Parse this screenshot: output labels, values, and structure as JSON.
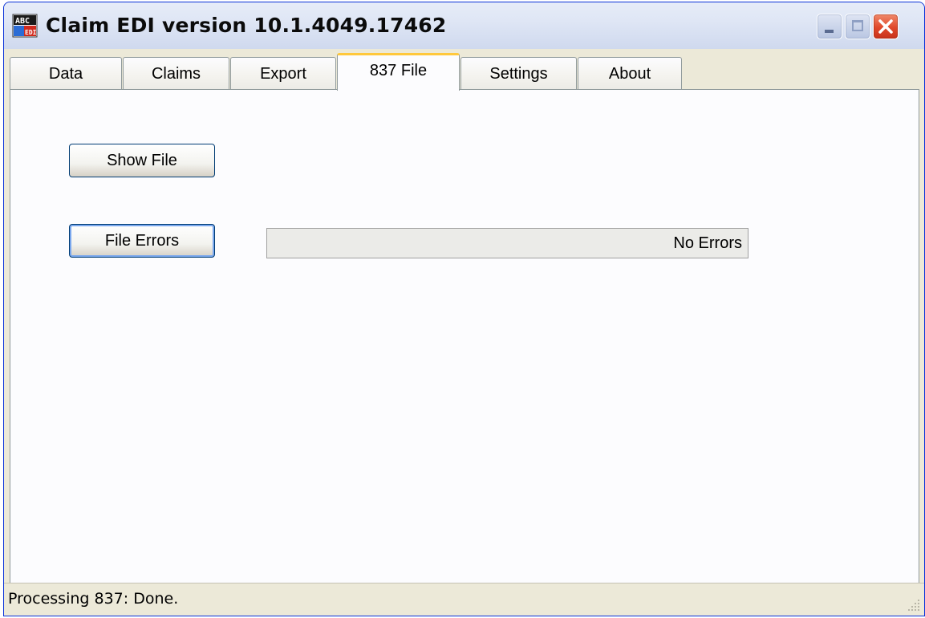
{
  "window": {
    "title": "Claim EDI version 10.1.4049.17462",
    "icon": "abc-edi-app-icon",
    "controls": [
      "minimize-icon",
      "maximize-icon",
      "close-icon"
    ]
  },
  "tabs": [
    {
      "label": "Data",
      "active": false
    },
    {
      "label": "Claims",
      "active": false
    },
    {
      "label": "Export",
      "active": false
    },
    {
      "label": "837 File",
      "active": true
    },
    {
      "label": "Settings",
      "active": false
    },
    {
      "label": "About",
      "active": false
    }
  ],
  "panel": {
    "show_file_label": "Show File",
    "file_errors_label": "File Errors",
    "errors_status": "No Errors"
  },
  "statusbar": {
    "text": "Processing 837: Done."
  },
  "colors": {
    "active_tab_accent": "#ffc83c",
    "close_button": "#e0482a",
    "button_border": "#003c74"
  }
}
